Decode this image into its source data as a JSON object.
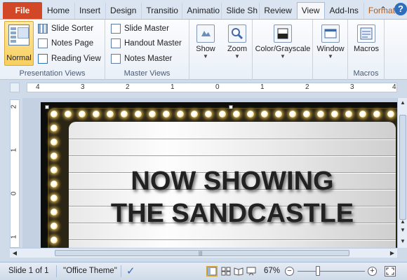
{
  "tabs": [
    {
      "label": "File"
    },
    {
      "label": "Home"
    },
    {
      "label": "Insert"
    },
    {
      "label": "Design"
    },
    {
      "label": "Transitio"
    },
    {
      "label": "Animatio"
    },
    {
      "label": "Slide Sh"
    },
    {
      "label": "Review"
    },
    {
      "label": "View"
    },
    {
      "label": "Add-Ins"
    },
    {
      "label": "Format"
    }
  ],
  "help_label": "?",
  "ribbon": {
    "presentation_views": {
      "label": "Presentation Views",
      "normal": "Normal",
      "slide_sorter": "Slide Sorter",
      "notes_page": "Notes Page",
      "reading_view": "Reading View"
    },
    "master_views": {
      "label": "Master Views",
      "slide_master": "Slide Master",
      "handout_master": "Handout Master",
      "notes_master": "Notes Master"
    },
    "show": "Show",
    "zoom": "Zoom",
    "color_grayscale": "Color/Grayscale",
    "window": "Window",
    "macros": {
      "button": "Macros",
      "label": "Macros"
    }
  },
  "ruler": {
    "h_ticks": [
      "4",
      "3",
      "2",
      "1",
      "0",
      "1",
      "2",
      "3",
      "4"
    ],
    "v_ticks": [
      "2",
      "1",
      "0",
      "1"
    ]
  },
  "slide": {
    "line1": "NOW SHOWING",
    "line2": "THE SANDCASTLE"
  },
  "status": {
    "slide_info": "Slide 1 of 1",
    "theme": "\"Office Theme\"",
    "zoom_level": "67%",
    "zoom_fraction": 0.3
  },
  "colors": {
    "file_tab": "#d24726",
    "active_view": "#fbd870",
    "bulb_glow": "#ffd25a"
  }
}
